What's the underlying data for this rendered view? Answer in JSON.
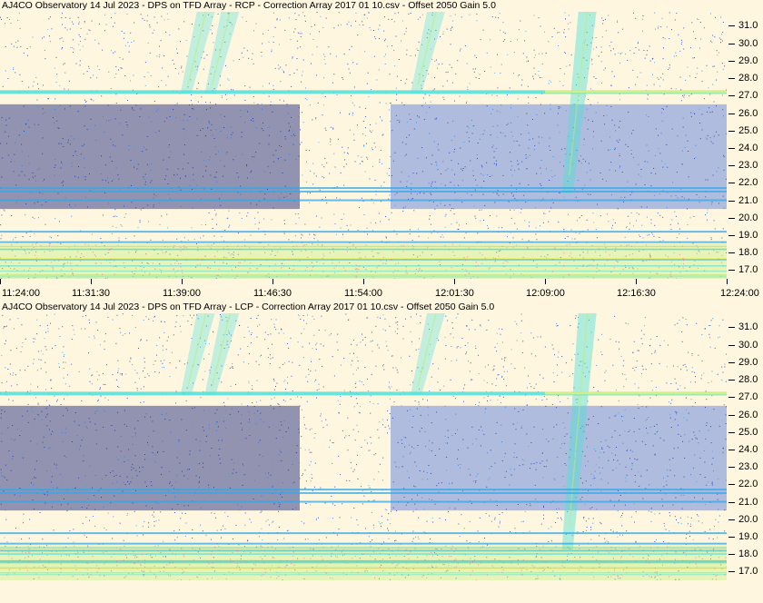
{
  "panels": [
    {
      "title": "AJ4CO Observatory 14 Jul 2023  -  DPS on TFD Array  -  RCP  -  Correction Array 2017 01 10.csv  -  Offset 2050  Gain 5.0",
      "polarization": "RCP"
    },
    {
      "title": "AJ4CO Observatory 14 Jul 2023  -  DPS on TFD Array  -  LCP  -  Correction Array 2017 01 10.csv  -  Offset 2050  Gain 5.0",
      "polarization": "LCP"
    }
  ],
  "chart_data": {
    "type": "heatmap",
    "x_tick_labels": [
      "11:24:00",
      "11:31:30",
      "11:39:00",
      "11:46:30",
      "11:54:00",
      "12:01:30",
      "12:09:00",
      "12:16:30",
      "12:24:00"
    ],
    "x_range": [
      "11:24:00",
      "12:24:00"
    ],
    "y_tick_labels": [
      "31.0",
      "30.0",
      "29.0",
      "28.0",
      "27.0",
      "26.0",
      "25.0",
      "24.0",
      "23.0",
      "22.0",
      "21.0",
      "20.0",
      "19.0",
      "18.0",
      "17.0"
    ],
    "y_range": [
      16.5,
      31.8
    ],
    "colormap": [
      "#0a1a78",
      "#1030b0",
      "#1c50d8",
      "#2a78e8",
      "#30a8e8",
      "#50e0d8",
      "#b8f070",
      "#f0f070",
      "#ff60a0"
    ],
    "features": {
      "horizontal_bands_mhz": [
        27.2,
        21.7,
        21.5,
        21.0,
        19.2,
        18.6,
        18.2,
        17.6
      ],
      "strong_bright_band_mhz": 27.15,
      "low_freq_bright_floor_mhz": 18.5,
      "drifting_bursts_time": [
        "11:39:30",
        "11:41:30",
        "11:58:30",
        "12:11:00"
      ]
    }
  }
}
